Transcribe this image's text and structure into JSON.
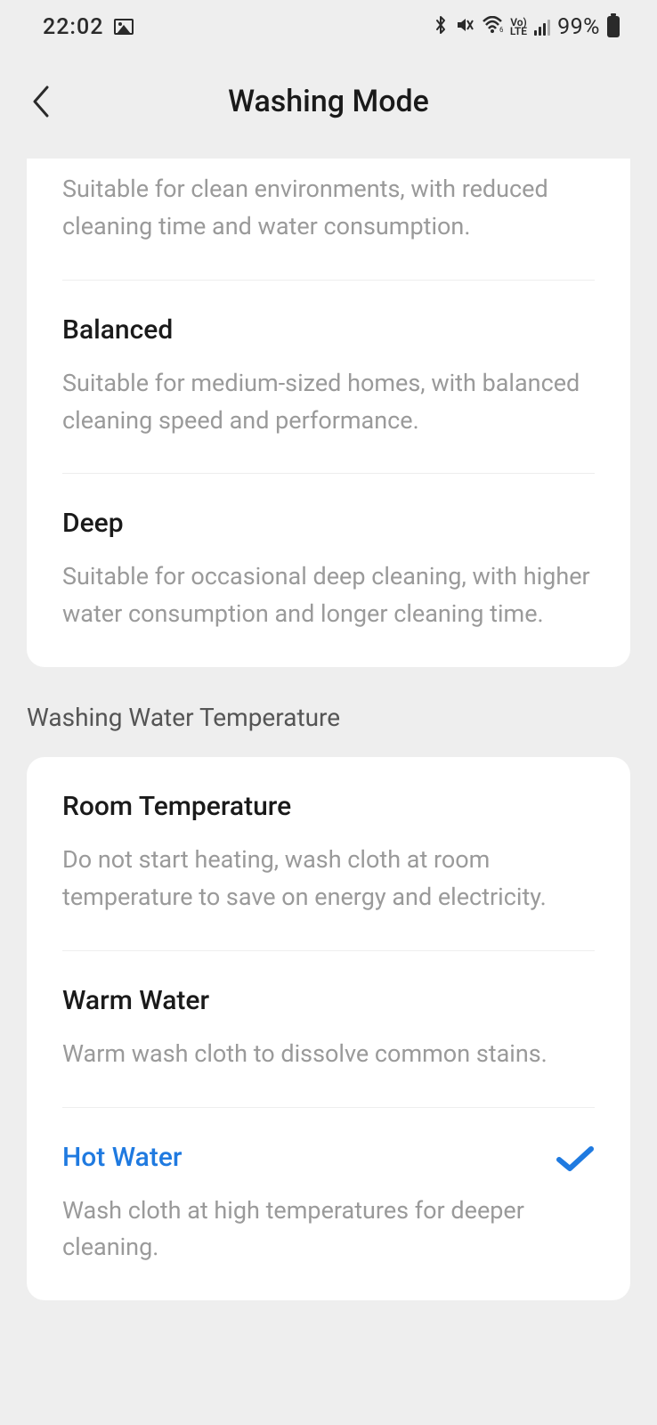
{
  "status": {
    "time": "22:02",
    "battery_pct": "99%",
    "lte_top": "Vo)",
    "lte_bottom": "LTE"
  },
  "header": {
    "title": "Washing Mode"
  },
  "modes": {
    "partial_desc": "Suitable for clean environments, with reduced cleaning time and water consumption.",
    "balanced": {
      "title": "Balanced",
      "desc": "Suitable for medium-sized homes, with balanced cleaning speed and performance."
    },
    "deep": {
      "title": "Deep",
      "desc": "Suitable for occasional deep cleaning, with higher water consumption and longer cleaning time."
    }
  },
  "temp": {
    "section_label": "Washing Water Temperature",
    "room": {
      "title": "Room Temperature",
      "desc": "Do not start heating, wash cloth at room temperature to save on energy and electricity."
    },
    "warm": {
      "title": "Warm Water",
      "desc": "Warm wash cloth to dissolve common stains."
    },
    "hot": {
      "title": "Hot Water",
      "desc": "Wash cloth at high temperatures for deeper cleaning."
    }
  }
}
